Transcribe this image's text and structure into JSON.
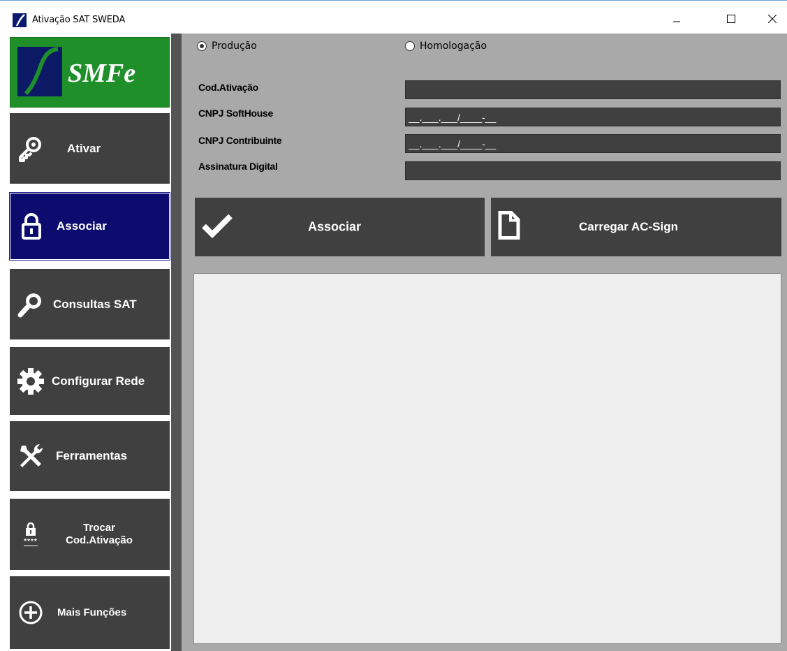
{
  "window": {
    "title": "Ativação SAT SWEDA",
    "icon": "sweda-logo-icon"
  },
  "logo": {
    "text": "SMFe"
  },
  "sidebar": {
    "items": [
      {
        "label": "Ativar",
        "icon": "key-icon"
      },
      {
        "label": "Associar",
        "icon": "padlock-icon",
        "active": true
      },
      {
        "label": "Consultas SAT",
        "icon": "magnifier-icon"
      },
      {
        "label": "Configurar Rede",
        "icon": "gear-icon"
      },
      {
        "label": "Ferramentas",
        "icon": "tools-icon"
      },
      {
        "label_line1": "Trocar",
        "label_line2": "Cod.Ativação",
        "icon": "lock-password-icon",
        "mask": "****"
      },
      {
        "label": "Mais Funções",
        "icon": "plus-circle-icon"
      }
    ]
  },
  "environment": {
    "options": [
      "Produção",
      "Homologação"
    ],
    "selected": "Produção"
  },
  "form": {
    "cod_ativacao_label": "Cod.Ativação",
    "cod_ativacao_value": "",
    "cnpj_softhouse_label": "CNPJ SoftHouse",
    "cnpj_softhouse_value": "__.___.___/____-__",
    "cnpj_contribuinte_label": "CNPJ Contribuinte",
    "cnpj_contribuinte_value": "__.___.___/____-__",
    "assinatura_label": "Assinatura Digital",
    "assinatura_value": ""
  },
  "actions": {
    "associar_label": "Associar",
    "carregar_label": "Carregar AC-Sign"
  },
  "colors": {
    "button_bg": "#404040",
    "active_bg": "#0c0c6e",
    "logo_bg": "#1f8f2a",
    "main_bg": "#a9a9a9",
    "output_bg": "#efefef"
  }
}
